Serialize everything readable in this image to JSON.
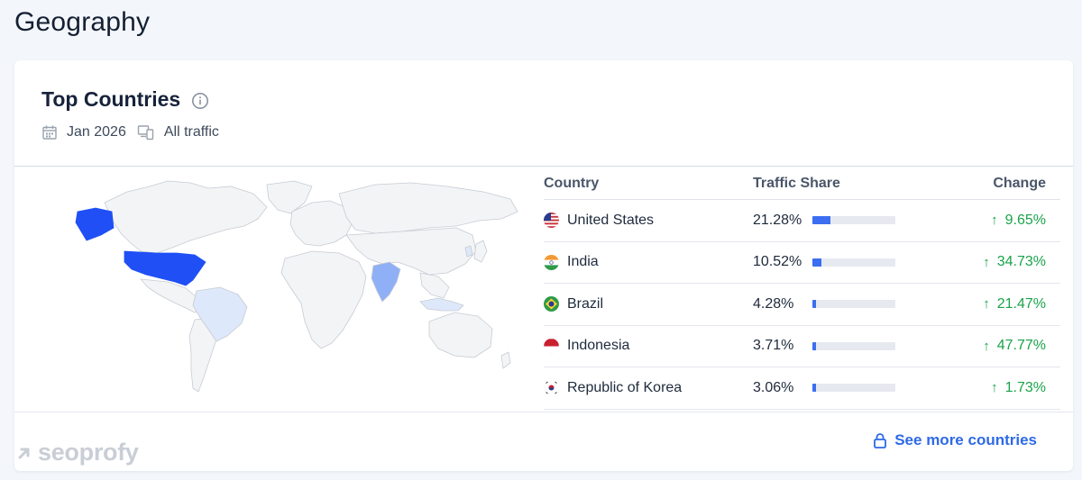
{
  "page": {
    "title": "Geography"
  },
  "card": {
    "title": "Top Countries",
    "date": "Jan 2026",
    "traffic": "All traffic"
  },
  "table": {
    "headers": {
      "country": "Country",
      "share": "Traffic Share",
      "change": "Change"
    },
    "rows": [
      {
        "country": "United States",
        "share": "21.28%",
        "share_fraction": 0.2128,
        "change": "9.65%",
        "direction": "up",
        "flag": "us-flag"
      },
      {
        "country": "India",
        "share": "10.52%",
        "share_fraction": 0.1052,
        "change": "34.73%",
        "direction": "up",
        "flag": "india-flag"
      },
      {
        "country": "Brazil",
        "share": "4.28%",
        "share_fraction": 0.0428,
        "change": "21.47%",
        "direction": "up",
        "flag": "brazil-flag"
      },
      {
        "country": "Indonesia",
        "share": "3.71%",
        "share_fraction": 0.0371,
        "change": "47.77%",
        "direction": "up",
        "flag": "indonesia-flag"
      },
      {
        "country": "Republic of Korea",
        "share": "3.06%",
        "share_fraction": 0.0306,
        "change": "1.73%",
        "direction": "up",
        "flag": "korea-flag"
      }
    ]
  },
  "footer": {
    "logo": "seoprofy",
    "see_more": "See more countries"
  },
  "colors": {
    "accent": "#3b6ef0",
    "link": "#2d6ae6",
    "positive": "#19a34a",
    "map_top": "#1f4ff5",
    "map_mid": "#8fb0f7",
    "map_low": "#dde8fb",
    "map_base": "#f3f4f6"
  }
}
